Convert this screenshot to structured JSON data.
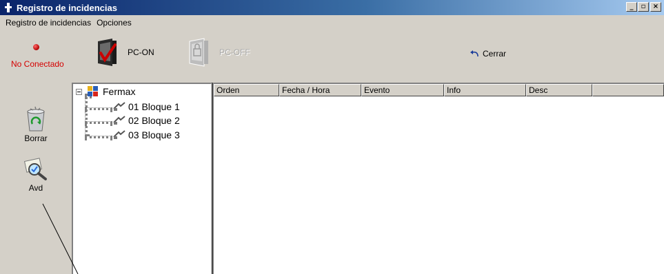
{
  "window": {
    "title": "Registro de incidencias",
    "controls": [
      "_",
      "▫",
      "×"
    ]
  },
  "menu": {
    "items": [
      "Registro de incidencias",
      "Opciones"
    ]
  },
  "toolbar": {
    "status_text": "No Conectado",
    "status_color": "#d40000",
    "pc_on_label": "PC-ON",
    "pc_off_label": "PC-OFF",
    "close_label": "Cerrar"
  },
  "sidebar": {
    "borrar_label": "Borrar",
    "avd_label": "Avd"
  },
  "tree": {
    "root": "Fermax",
    "children": [
      "01 Bloque 1",
      "02 Bloque 2",
      "03 Bloque 3"
    ]
  },
  "list": {
    "columns": [
      "Orden",
      "Fecha / Hora",
      "Evento",
      "Info",
      "Desc",
      ""
    ]
  }
}
